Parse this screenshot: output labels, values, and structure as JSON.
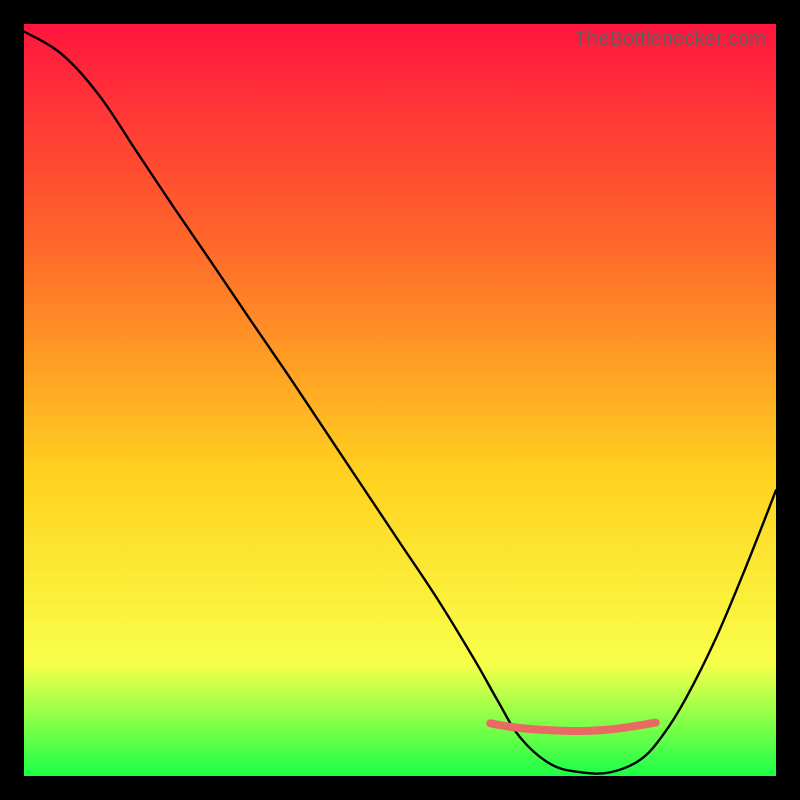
{
  "watermark": "TheBottlenecker.com",
  "colors": {
    "gradient_top": "#ff153e",
    "gradient_mid1": "#ff6a2a",
    "gradient_mid2": "#ffd21f",
    "gradient_mid3": "#f8ff4a",
    "gradient_bottom": "#1aff47",
    "curve": "#000000",
    "band": "#e86a63",
    "frame": "#000000"
  },
  "chart_data": {
    "type": "line",
    "title": "",
    "xlabel": "",
    "ylabel": "",
    "xlim": [
      0,
      100
    ],
    "ylim": [
      0,
      100
    ],
    "grid": false,
    "series": [
      {
        "name": "bottleneck-curve",
        "x": [
          0,
          5,
          10,
          15,
          20,
          25,
          30,
          35,
          40,
          45,
          50,
          55,
          60,
          63,
          66,
          70,
          74,
          78,
          82,
          85,
          88,
          92,
          96,
          100
        ],
        "values": [
          99,
          96,
          90.5,
          83,
          75.5,
          68.2,
          60.8,
          53.5,
          46,
          38.5,
          31,
          23.5,
          15.3,
          10,
          5.1,
          1.6,
          0.5,
          0.5,
          2.2,
          5.5,
          10.3,
          18.3,
          27.8,
          38
        ]
      },
      {
        "name": "optimal-band",
        "x": [
          62,
          65,
          68,
          72,
          75,
          78,
          81,
          84
        ],
        "values": [
          7.0,
          6.5,
          6.2,
          6.0,
          6.0,
          6.2,
          6.6,
          7.1
        ]
      }
    ],
    "annotations": []
  }
}
